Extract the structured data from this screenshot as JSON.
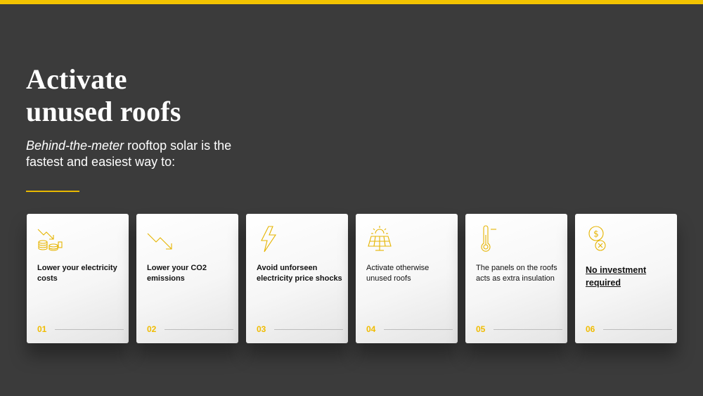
{
  "slide": {
    "title_line1": "Activate",
    "title_line2": "unused roofs",
    "subtitle_italic": "Behind-the-meter",
    "subtitle_rest": " rooftop solar is the fastest and easiest way to:",
    "accent_color": "#f2c300",
    "background_color": "#3b3b3b"
  },
  "cards": [
    {
      "number": "01",
      "label": "Lower your electricity costs",
      "icon": "cost-down-coins-icon"
    },
    {
      "number": "02",
      "label": "Lower your CO2 emissions",
      "icon": "trend-down-arrow-icon"
    },
    {
      "number": "03",
      "label": "Avoid unforseen electricity price shocks",
      "icon": "lightning-bolt-icon"
    },
    {
      "number": "04",
      "label": "Activate otherwise unused roofs",
      "icon": "solar-panel-sun-icon"
    },
    {
      "number": "05",
      "label": "The panels on the roofs acts as extra insulation",
      "icon": "thermometer-icon"
    },
    {
      "number": "06",
      "label": "No investment required",
      "icon": "dollar-no-cost-icon"
    }
  ]
}
